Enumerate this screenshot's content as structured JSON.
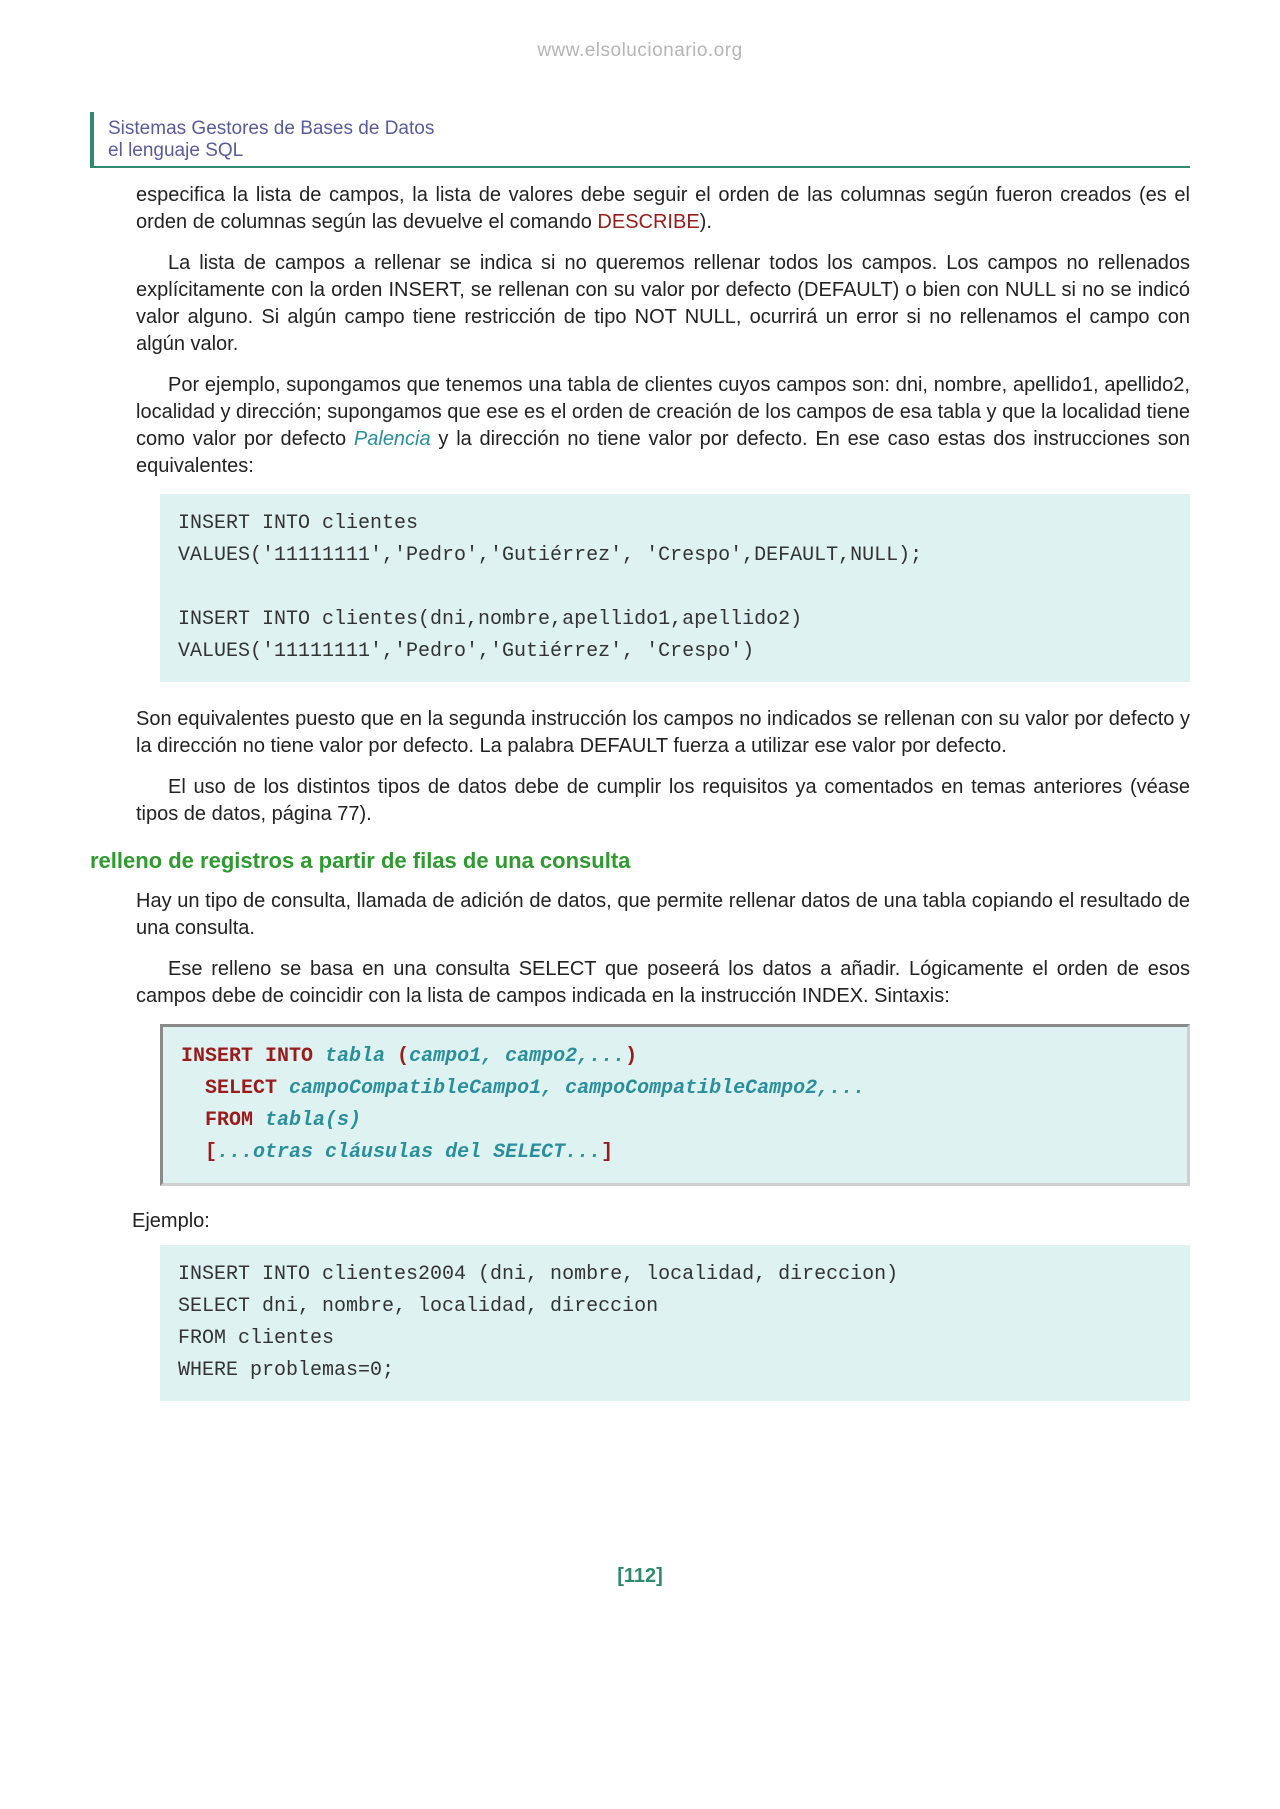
{
  "watermark": "www.elsolucionario.org",
  "header": {
    "line1": "Sistemas Gestores de Bases de Datos",
    "line2": "el lenguaje SQL"
  },
  "para1": {
    "pre": "especifica la lista de campos, la lista de valores debe seguir el orden de las columnas según fueron creados (es el orden de columnas según las devuelve el comando ",
    "kw": "DESCRIBE",
    "post": ")."
  },
  "para2": "La lista de campos a rellenar se indica si no queremos rellenar todos los campos. Los campos no rellenados explícitamente con la orden INSERT, se rellenan con su valor por defecto (DEFAULT) o bien con NULL si no se indicó valor alguno. Si algún campo tiene restricción de tipo NOT NULL, ocurrirá un error si no rellenamos el campo con algún valor.",
  "para3": {
    "pre": "Por ejemplo, supongamos que tenemos una tabla de clientes cuyos campos son: dni, nombre, apellido1, apellido2, localidad y dirección; supongamos que ese es el orden de creación de los campos de esa tabla y que la localidad tiene como valor por defecto ",
    "kw": "Palencia",
    "post": " y la dirección no tiene valor por defecto. En ese caso estas dos instrucciones son equivalentes:"
  },
  "code1": "INSERT INTO clientes\nVALUES('11111111','Pedro','Gutiérrez', 'Crespo',DEFAULT,NULL);\n\nINSERT INTO clientes(dni,nombre,apellido1,apellido2)\nVALUES('11111111','Pedro','Gutiérrez', 'Crespo')",
  "para4": "Son equivalentes puesto que en la segunda instrucción los campos no indicados se rellenan con su valor por defecto y la dirección no tiene valor por defecto. La palabra DEFAULT fuerza a utilizar ese valor por defecto.",
  "para5": "El uso de los distintos tipos de datos debe de cumplir los requisitos ya comentados en temas anteriores (véase tipos de datos, página 77).",
  "section_heading": "relleno de registros a partir de filas de una consulta",
  "para6": "Hay un tipo de consulta, llamada de adición de datos, que permite rellenar datos de una tabla copiando el resultado de una consulta.",
  "para7": "Ese relleno se basa en una consulta SELECT que poseerá los datos a añadir. Lógicamente el orden de esos campos debe de coincidir con la lista de campos indicada en la instrucción INDEX. Sintaxis:",
  "syntax": {
    "l1_kw": "INSERT INTO",
    "l1_it": " tabla ",
    "l1_p1": "(",
    "l1_it2": "campo1, campo2,...",
    "l1_p2": ")",
    "l2_kw": "SELECT",
    "l2_it": " campoCompatibleCampo1, campoCompatibleCampo2,...",
    "l3_kw": "FROM",
    "l3_it": " tabla(s)",
    "l4_p1": "[",
    "l4_it": "...otras cláusulas del SELECT...",
    "l4_p2": "]"
  },
  "ejemplo_label": "Ejemplo:",
  "code2": "INSERT INTO clientes2004 (dni, nombre, localidad, direccion)\nSELECT dni, nombre, localidad, direccion\nFROM clientes\nWHERE problemas=0;",
  "page_number": "[112]"
}
